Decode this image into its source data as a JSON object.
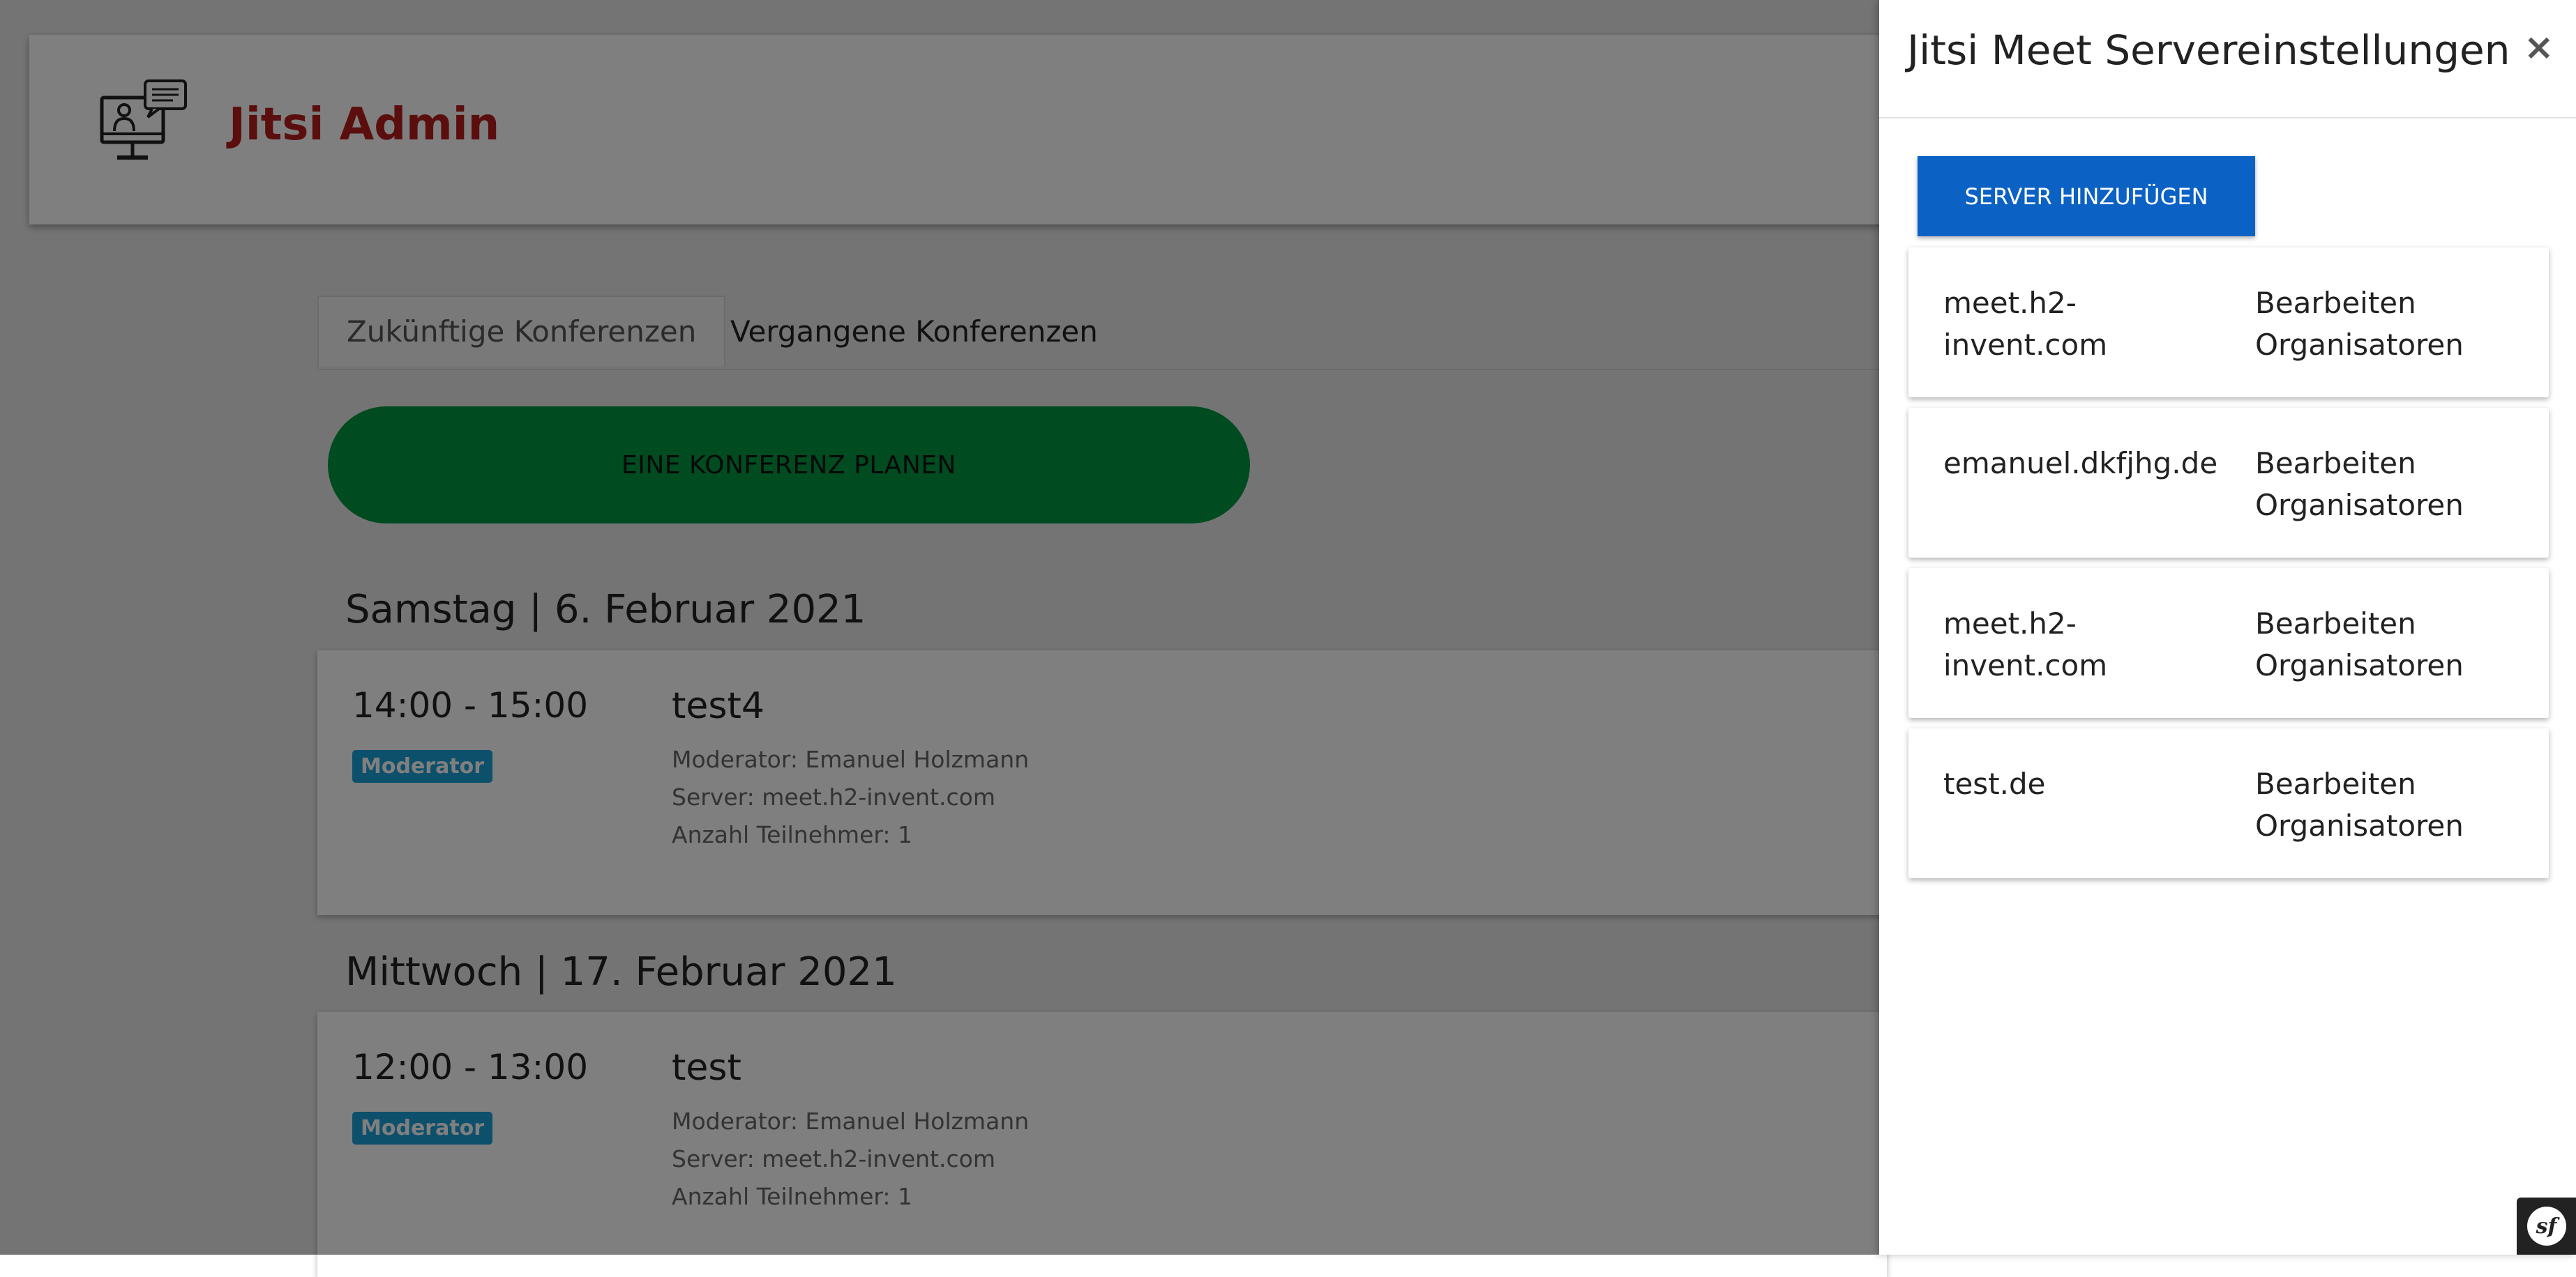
{
  "app": {
    "name": "Jitsi Admin",
    "logo_icon": "monitor-chat-user-icon",
    "brand_color": "#b71c1c"
  },
  "tabs": [
    {
      "label": "Zukünftige Konferenzen",
      "active": true
    },
    {
      "label": "Vergangene Konferenzen",
      "active": false
    }
  ],
  "plan_button": {
    "label": "EINE KONFERENZ PLANEN",
    "color": "#00963f"
  },
  "days": [
    {
      "heading": "Samstag | 6. Februar 2021",
      "conference": {
        "time": "14:00 - 15:00",
        "badge": "Moderator",
        "title": "test4",
        "moderator": "Moderator: Emanuel Holzmann",
        "server": "Server: meet.h2-invent.com",
        "participants": "Anzahl Teilnehmer: 1"
      }
    },
    {
      "heading": "Mittwoch | 17. Februar 2021",
      "conference": {
        "time": "12:00 - 13:00",
        "badge": "Moderator",
        "title": "test",
        "moderator": "Moderator: Emanuel Holzmann",
        "server": "Server: meet.h2-invent.com",
        "participants": "Anzahl Teilnehmer: 1"
      }
    }
  ],
  "panel": {
    "title": "Jitsi Meet Servereinstellungen",
    "close_glyph": "×",
    "add_button": "SERVER HINZUFÜGEN",
    "add_button_color": "#0b61c4",
    "servers": [
      {
        "name": "meet.h2-invent.com",
        "edit": "Bearbeiten",
        "organizers": "Organisatoren"
      },
      {
        "name": "emanuel.dkfjhg.de",
        "edit": "Bearbeiten",
        "organizers": "Organisatoren"
      },
      {
        "name": "meet.h2-invent.com",
        "edit": "Bearbeiten",
        "organizers": "Organisatoren"
      },
      {
        "name": "test.de",
        "edit": "Bearbeiten",
        "organizers": "Organisatoren"
      }
    ]
  },
  "toolbar": {
    "symfony_label": "sf"
  }
}
